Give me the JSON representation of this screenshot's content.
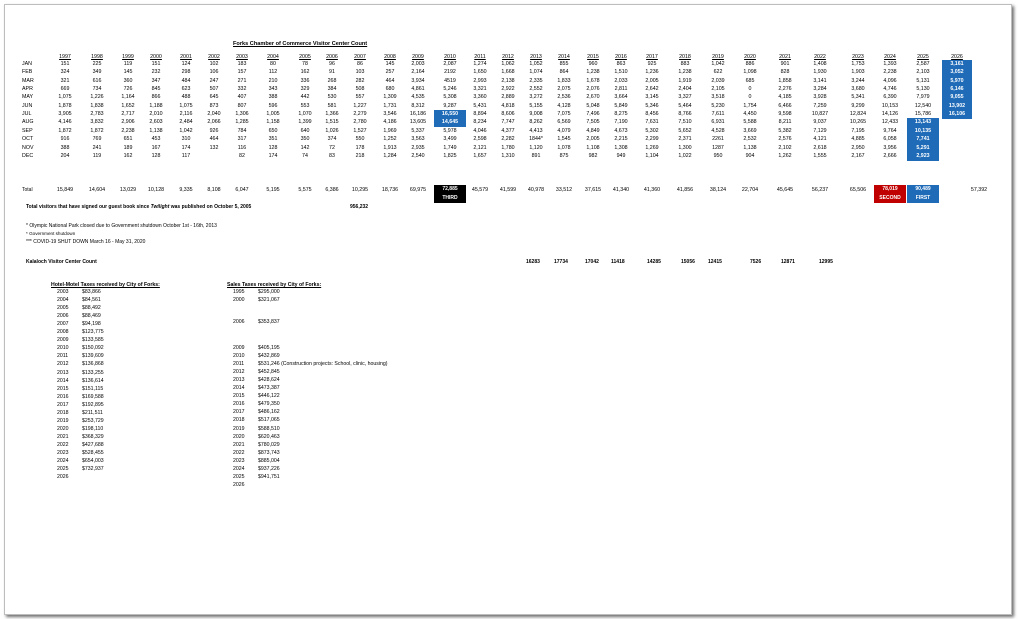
{
  "title": "Forks Chamber of Commerce Visitor Center Count",
  "years": [
    "1997",
    "1998",
    "1999",
    "2000",
    "2001",
    "2002",
    "2003",
    "2004",
    "2005",
    "2006",
    "2007",
    "2008",
    "2009",
    "2010",
    "2011",
    "2012",
    "2013",
    "2014",
    "2015",
    "2016",
    "2017",
    "2018",
    "2019",
    "2020",
    "2021",
    "2022",
    "2023",
    "2024",
    "2025",
    "2026"
  ],
  "months": [
    "JAN",
    "FEB",
    "MAR",
    "APR",
    "MAY",
    "JUN",
    "JUL",
    "AUG",
    "SEP",
    "OCT",
    "NOV",
    "DEC"
  ],
  "rows": [
    [
      "151",
      "225",
      "119",
      "151",
      "124",
      "102",
      "183",
      "80",
      "78",
      "96",
      "86",
      "145",
      "2,003",
      "2,087",
      "1,274",
      "1,062",
      "1,052",
      "855",
      "960",
      "863",
      "925",
      "883",
      "1,042",
      "886",
      "901",
      "1,408",
      "1,753",
      "1,393",
      "2,587",
      "3,161"
    ],
    [
      "324",
      "349",
      "145",
      "232",
      "298",
      "106",
      "157",
      "112",
      "162",
      "91",
      "103",
      "257",
      "2,164",
      "2192",
      "1,650",
      "1,668",
      "1,074",
      "864",
      "1,238",
      "1,510",
      "1,236",
      "1,238",
      "622",
      "1,098",
      "828",
      "1,930",
      "1,903",
      "2,238",
      "2,103",
      "3,052"
    ],
    [
      "321",
      "616",
      "360",
      "347",
      "484",
      "247",
      "271",
      "210",
      "336",
      "268",
      "282",
      "464",
      "3,934",
      "4519",
      "2,993",
      "2,138",
      "2,335",
      "1,833",
      "1,678",
      "2,033",
      "2,005",
      "1,919",
      "2,039",
      "685",
      "1,858",
      "3,141",
      "3,244",
      "4,096",
      "5,131",
      "5,970"
    ],
    [
      "669",
      "734",
      "726",
      "845",
      "623",
      "507",
      "332",
      "343",
      "329",
      "384",
      "508",
      "680",
      "4,861",
      "5,246",
      "3,321",
      "2,922",
      "2,552",
      "2,075",
      "2,076",
      "2,811",
      "2,642",
      "2,404",
      "2,105",
      "0",
      "2,276",
      "3,284",
      "3,680",
      "4,746",
      "5,130",
      "6,146"
    ],
    [
      "1,075",
      "1,226",
      "1,164",
      "866",
      "488",
      "645",
      "407",
      "388",
      "442",
      "530",
      "557",
      "1,309",
      "4,535",
      "5,308",
      "3,360",
      "2,889",
      "3,272",
      "2,536",
      "2,670",
      "3,664",
      "3,145",
      "3,327",
      "3,518",
      "0",
      "4,185",
      "3,928",
      "5,341",
      "6,390",
      "7,979",
      "9,055"
    ],
    [
      "1,878",
      "1,838",
      "1,652",
      "1,188",
      "1,075",
      "873",
      "807",
      "596",
      "553",
      "581",
      "1,227",
      "1,731",
      "8,312",
      "9,287",
      "5,431",
      "4,818",
      "5,155",
      "4,128",
      "5,048",
      "5,849",
      "5,346",
      "5,464",
      "5,230",
      "1,754",
      "6,466",
      "7,259",
      "9,299",
      "10,153",
      "12,540",
      "13,902"
    ],
    [
      "3,905",
      "2,783",
      "2,717",
      "2,010",
      "2,116",
      "2,040",
      "1,306",
      "1,005",
      "1,070",
      "1,366",
      "2,279",
      "3,546",
      "16,186",
      "16,550",
      "8,894",
      "8,606",
      "9,008",
      "7,075",
      "7,496",
      "8,275",
      "8,456",
      "8,766",
      "7,611",
      "4,450",
      "9,598",
      "10,827",
      "12,824",
      "14,126",
      "15,786",
      "16,106"
    ],
    [
      "4,146",
      "3,832",
      "2,906",
      "2,603",
      "2,484",
      "2,066",
      "1,285",
      "1,158",
      "1,399",
      "1,515",
      "2,780",
      "4,186",
      "13,605",
      "14,645",
      "8,234",
      "7,747",
      "8,262",
      "6,569",
      "7,505",
      "7,190",
      "7,631",
      "7,510",
      "6,931",
      "5,588",
      "8,211",
      "9,037",
      "10,265",
      "12,433",
      "13,143",
      ""
    ],
    [
      "1,872",
      "1,872",
      "2,238",
      "1,138",
      "1,042",
      "926",
      "784",
      "650",
      "640",
      "1,026",
      "1,527",
      "1,969",
      "5,337",
      "5,978",
      "4,046",
      "4,377",
      "4,413",
      "4,079",
      "4,849",
      "4,673",
      "5,302",
      "5,652",
      "4,528",
      "3,669",
      "5,382",
      "7,129",
      "7,195",
      "9,764",
      "10,135",
      ""
    ],
    [
      "916",
      "769",
      "651",
      "453",
      "310",
      "464",
      "317",
      "351",
      "350",
      "374",
      "550",
      "1,252",
      "3,563",
      "3,499",
      "2,598",
      "2,282",
      "1844*",
      "1,545",
      "2,005",
      "2,215",
      "2,299",
      "2,371",
      "2261",
      "2,532",
      "2,576",
      "4,121",
      "4,885",
      "6,058",
      "7,741",
      ""
    ],
    [
      "388",
      "241",
      "189",
      "167",
      "174",
      "132",
      "116",
      "128",
      "142",
      "72",
      "178",
      "1,913",
      "2,935",
      "1,749",
      "2,121",
      "1,780",
      "1,120",
      "1,078",
      "1,108",
      "1,308",
      "1,269",
      "1,300",
      "1287",
      "1,138",
      "2,102",
      "2,618",
      "2,950",
      "3,956",
      "5,291",
      ""
    ],
    [
      "204",
      "119",
      "162",
      "128",
      "117",
      "",
      "82",
      "174",
      "74",
      "83",
      "218",
      "1,284",
      "2,540",
      "1,825",
      "1,657",
      "1,310",
      "891",
      "875",
      "982",
      "949",
      "1,104",
      "1,022",
      "950",
      "904",
      "1,262",
      "1,555",
      "2,167",
      "2,666",
      "2,923",
      ""
    ]
  ],
  "totals_label": "Total",
  "totals": [
    "15,849",
    "14,604",
    "13,029",
    "10,128",
    "9,335",
    "8,108",
    "6,047",
    "5,195",
    "5,575",
    "6,386",
    "10,295",
    "18,736",
    "69,975",
    "72,885",
    "45,579",
    "41,599",
    "40,978",
    "33,512",
    "37,615",
    "41,340",
    "41,360",
    "41,856",
    "38,124",
    "22,704",
    "45,645",
    "56,237",
    "65,506",
    "78,019",
    "90,489",
    "57,392"
  ],
  "rank_labels": {
    "third": "THIRD",
    "second": "SECOND",
    "first": "FIRST"
  },
  "rank_colors": {
    "first": "#1f6bb8",
    "second": "#c00000",
    "third": "#000000",
    "highlight": "#1f6bb8"
  },
  "guestbook": {
    "label_pre": "Total visitors that have signed our guest book since ",
    "label_em": "Twilight",
    "label_post": " was published on October 5, 2005",
    "value": "956,232"
  },
  "notes": [
    "* Olympic National Park closed due to Government shutdown October 1st - 16th, 2013",
    "* Government shutdown",
    "*** COVID-19 SHUT DOWN March 16 - May 31, 2020"
  ],
  "kalaloch": {
    "label": "Kalaloch Visitor Center Count",
    "values": [
      "16283",
      "17734",
      "17042",
      "11418",
      "14285",
      "15056",
      "12415",
      "7526",
      "12871",
      "12995"
    ]
  },
  "hotel": {
    "title": "Hotel-Motel Taxes received by City of Forks:",
    "rows": [
      [
        "2003",
        "$83,866"
      ],
      [
        "2004",
        "$84,561"
      ],
      [
        "2005",
        "$88,492"
      ],
      [
        "2006",
        "$88,469"
      ],
      [
        "2007",
        "$94,198"
      ],
      [
        "2008",
        "$123,775"
      ],
      [
        "2009",
        "$133,585"
      ],
      [
        "2010",
        "$150,092"
      ],
      [
        "2011",
        "$139,609"
      ],
      [
        "2012",
        "$136,868"
      ],
      [
        "2013",
        "$133,255"
      ],
      [
        "2014",
        "$136,614"
      ],
      [
        "2015",
        "$151,115"
      ],
      [
        "2016",
        "$169,588"
      ],
      [
        "2017",
        "$192,895"
      ],
      [
        "2018",
        "$211,511"
      ],
      [
        "2019",
        "$253,729"
      ],
      [
        "2020",
        "$198,110"
      ],
      [
        "2021",
        "$368,329"
      ],
      [
        "2022",
        "$427,688"
      ],
      [
        "2023",
        "$528,455"
      ],
      [
        "2024",
        "$654,003"
      ],
      [
        "2025",
        "$732,937"
      ],
      [
        "2026",
        ""
      ]
    ]
  },
  "sales": {
    "title": "Sales Taxes received by City of Forks:",
    "top_rows": [
      [
        "1995",
        "$295,000"
      ],
      [
        "2000",
        "$321,067"
      ]
    ],
    "row_2006": [
      "2006",
      "$353,837"
    ],
    "rows": [
      [
        "2009",
        "$405,195"
      ],
      [
        "2010",
        "$432,869"
      ],
      [
        "2011",
        "$531,246 (Construction projects: School, clinic, housing)"
      ],
      [
        "2012",
        "$452,845"
      ],
      [
        "2013",
        "$428,624"
      ],
      [
        "2014",
        "$473,387"
      ],
      [
        "2015",
        "$446,122"
      ],
      [
        "2016",
        "$479,350"
      ],
      [
        "2017",
        "$486,162"
      ],
      [
        "2018",
        "$517,065"
      ],
      [
        "2019",
        "$588,510"
      ],
      [
        "2020",
        "$620,463"
      ],
      [
        "2021",
        "$780,029"
      ],
      [
        "2022",
        "$873,743"
      ],
      [
        "2023",
        "$885,004"
      ],
      [
        "2024",
        "$937,226"
      ],
      [
        "2025",
        "$941,751"
      ],
      [
        "2026",
        ""
      ]
    ]
  }
}
